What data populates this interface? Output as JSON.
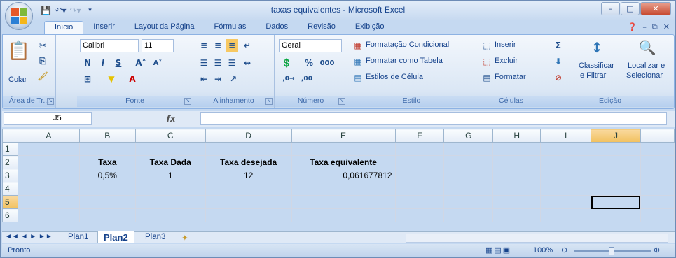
{
  "window": {
    "title": "taxas equivalentes - Microsoft Excel"
  },
  "tabs": [
    "Início",
    "Inserir",
    "Layout da Página",
    "Fórmulas",
    "Dados",
    "Revisão",
    "Exibição"
  ],
  "active_tab": "Início",
  "ribbon": {
    "clipboard": {
      "paste": "Colar",
      "label": "Área de Tr..."
    },
    "font": {
      "name": "Calibri",
      "size": "11",
      "label": "Fonte"
    },
    "alignment": {
      "label": "Alinhamento"
    },
    "number": {
      "format": "Geral",
      "label": "Número"
    },
    "styles": {
      "cond": "Formatação Condicional",
      "table": "Formatar como Tabela",
      "cell": "Estilos de Célula",
      "label": "Estilo"
    },
    "cells": {
      "insert": "Inserir",
      "delete": "Excluir",
      "format": "Formatar",
      "label": "Células"
    },
    "editing": {
      "sort": "Classificar",
      "sort2": "e Filtrar",
      "find": "Localizar e",
      "find2": "Selecionar",
      "label": "Edição"
    }
  },
  "formula_bar": {
    "name_box": "J5",
    "fx": "fx",
    "formula": ""
  },
  "grid": {
    "columns": [
      "A",
      "B",
      "C",
      "D",
      "E",
      "F",
      "G",
      "H",
      "I",
      "J"
    ],
    "rows": [
      [
        "",
        "",
        "",
        "",
        "",
        "",
        "",
        "",
        "",
        ""
      ],
      [
        "",
        "Taxa",
        "Taxa Dada",
        "Taxa desejada",
        "Taxa equivalente",
        "",
        "",
        "",
        "",
        ""
      ],
      [
        "",
        "0,5%",
        "1",
        "12",
        "0,061677812",
        "",
        "",
        "",
        "",
        ""
      ],
      [
        "",
        "",
        "",
        "",
        "",
        "",
        "",
        "",
        "",
        ""
      ],
      [
        "",
        "",
        "",
        "",
        "",
        "",
        "",
        "",
        "",
        ""
      ],
      [
        "",
        "",
        "",
        "",
        "",
        "",
        "",
        "",
        "",
        ""
      ]
    ],
    "row_numbers": [
      "1",
      "2",
      "3",
      "4",
      "5",
      "6"
    ],
    "selected_cell": "J5"
  },
  "sheets": [
    "Plan1",
    "Plan2",
    "Plan3"
  ],
  "active_sheet": "Plan2",
  "status": {
    "text": "Pronto",
    "zoom": "100%"
  }
}
